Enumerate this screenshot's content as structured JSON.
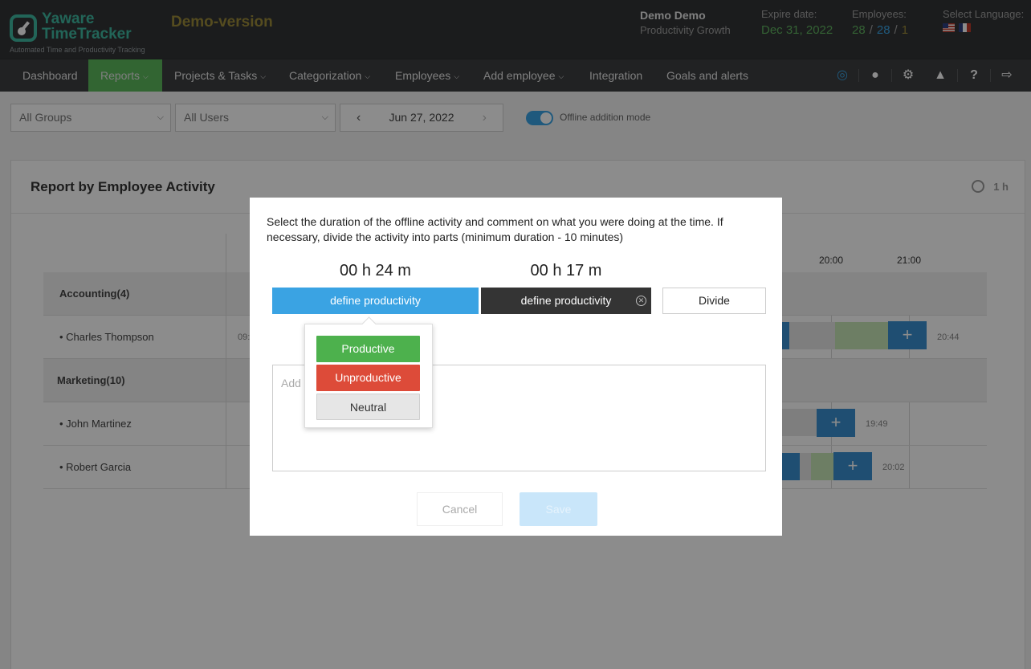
{
  "header": {
    "logo_line1": "Yaware",
    "logo_line2": "TimeTracker",
    "logo_tagline": "Automated Time and Productivity Tracking",
    "demo_label": "Demo-version",
    "user_name": "Demo Demo",
    "user_plan": "Productivity Growth",
    "expire_label": "Expire date:",
    "expire_value": "Dec 31, 2022",
    "employees_label": "Employees:",
    "employees_a": "28",
    "employees_b": "28",
    "employees_c": "1",
    "language_label": "Select Language:"
  },
  "nav": {
    "items": [
      "Dashboard",
      "Reports",
      "Projects & Tasks",
      "Categorization",
      "Employees",
      "Add employee",
      "Integration",
      "Goals and alerts"
    ],
    "icons": [
      "lightbulb-icon",
      "user-icon",
      "gear-icon",
      "graduation-cap-icon",
      "help-icon",
      "logout-icon"
    ]
  },
  "filters": {
    "groups": "All Groups",
    "users": "All Users",
    "date": "Jun 27, 2022",
    "offline_mode": "Offline addition mode"
  },
  "report": {
    "title": "Report by Employee Activity",
    "period": "1 h",
    "time_headers": [
      "20:00",
      "21:00"
    ],
    "rows": [
      {
        "label": "Accounting(4)",
        "group": true
      },
      {
        "label": "• Charles Thompson",
        "group": false,
        "start": "09:",
        "end": "20:44"
      },
      {
        "label": "Marketing(10)",
        "group": true
      },
      {
        "label": "• John Martinez",
        "group": false,
        "end": "19:49"
      },
      {
        "label": "• Robert Garcia",
        "group": false,
        "end": "20:02"
      }
    ]
  },
  "modal": {
    "instructions": "Select the duration of the offline activity and comment on what you were doing at the time. If necessary, divide the activity into parts (minimum duration - 10 minutes)",
    "duration_1": "00 h 24 m",
    "duration_2": "00 h 17 m",
    "segment_1": "define productivity",
    "segment_2": "define productivity",
    "divide": "Divide",
    "comment_placeholder": "Add",
    "cancel": "Cancel",
    "save": "Save",
    "options": {
      "productive": "Productive",
      "unproductive": "Unproductive",
      "neutral": "Neutral"
    }
  },
  "colors": {
    "accent_blue": "#3aa3e3",
    "productive": "#4db14d",
    "unproductive": "#dd4b39",
    "active_nav": "#5cb85c"
  }
}
